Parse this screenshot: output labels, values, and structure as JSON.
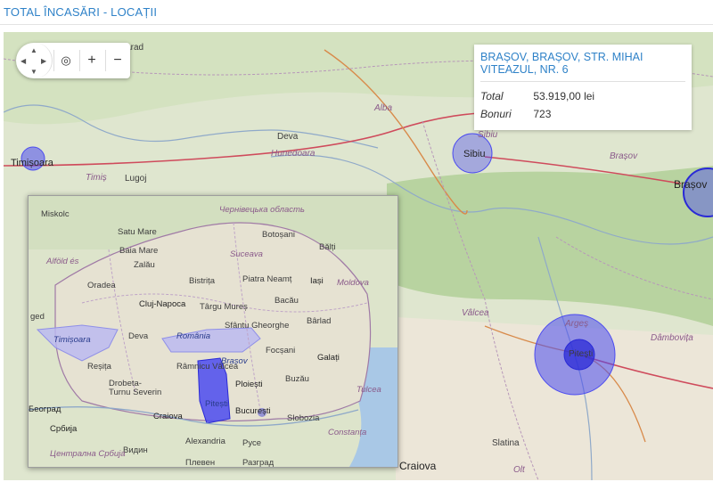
{
  "header": {
    "title": "TOTAL ÎNCASĂRI - LOCAȚII"
  },
  "controls": {
    "zoom_in": "+",
    "zoom_out": "−",
    "globe_icon": "globe-icon",
    "pan_icon": "pan-arrows-icon"
  },
  "popup": {
    "title": "BRAȘOV, BRAȘOV, STR. MIHAI VITEAZUL, NR. 6",
    "rows": [
      {
        "key": "Total",
        "value": "53.919,00 lei"
      },
      {
        "key": "Bonuri",
        "value": "723"
      }
    ]
  },
  "map_labels": {
    "arad": "Arad",
    "timisoara": "Timișoara",
    "timis": "Timiș",
    "lugoj": "Lugoj",
    "deva": "Deva",
    "hunedoara": "Hunedoara",
    "alba": "Alba",
    "sibiu_region": "Sibiu",
    "sibiu_city": "Sibiu",
    "brasov_region": "Brașov",
    "brasov_city": "Brașov",
    "valcea": "Vâlcea",
    "arges": "Argeș",
    "pitesti": "Pitești",
    "dambovita": "Dâmbovița",
    "slatina": "Slatina",
    "olt": "Olt",
    "craiova": "Craiova"
  },
  "inset_labels": {
    "miskolc": "Miskolc",
    "satu_mare": "Satu Mare",
    "baia_mare": "Baia Mare",
    "zalau": "Zalău",
    "oradea": "Oradea",
    "alfold": "Alföld és",
    "cluj": "Cluj-Napoca",
    "bistrita": "Bistrița",
    "targu_mures": "Târgu Mureș",
    "piatra_neamt": "Piatra Neamț",
    "bacau": "Bacău",
    "iasi": "Iași",
    "botosani": "Botoșani",
    "balti": "Bălți",
    "suceava": "Suceava",
    "chernivtsi": "Чернівецька область",
    "moldova": "Moldova",
    "barlad": "Bârlad",
    "ged": "ged",
    "timisoara": "Timișoara",
    "deva": "Deva",
    "romania": "România",
    "sf_gheorghe": "Sfântu Gheorghe",
    "brasov": "Brașov",
    "focsani": "Focșani",
    "galati": "Galați",
    "resita": "Reșița",
    "ramnicu": "Râmnicu Vâlcea",
    "ploiesti": "Ploiești",
    "drobeta": "Drobeta-Turnu Severin",
    "buzau": "Buzău",
    "tulcea": "Tulcea",
    "beograd": "Београд",
    "srbija": "Србија",
    "craiova": "Craiova",
    "pitesti": "Pitești",
    "bucuresti": "București",
    "slobozia": "Slobozia",
    "constanta": "Constanța",
    "vidin": "Видин",
    "alexandria": "Alexandria",
    "ruse": "Русе",
    "centralna": "Централна Србија",
    "pleven": "Плевен",
    "razgrad": "Разград"
  },
  "colors": {
    "accent": "#2f82c8",
    "bubble": "#4b4bf0",
    "bubble_dark": "#2a2ad6"
  }
}
